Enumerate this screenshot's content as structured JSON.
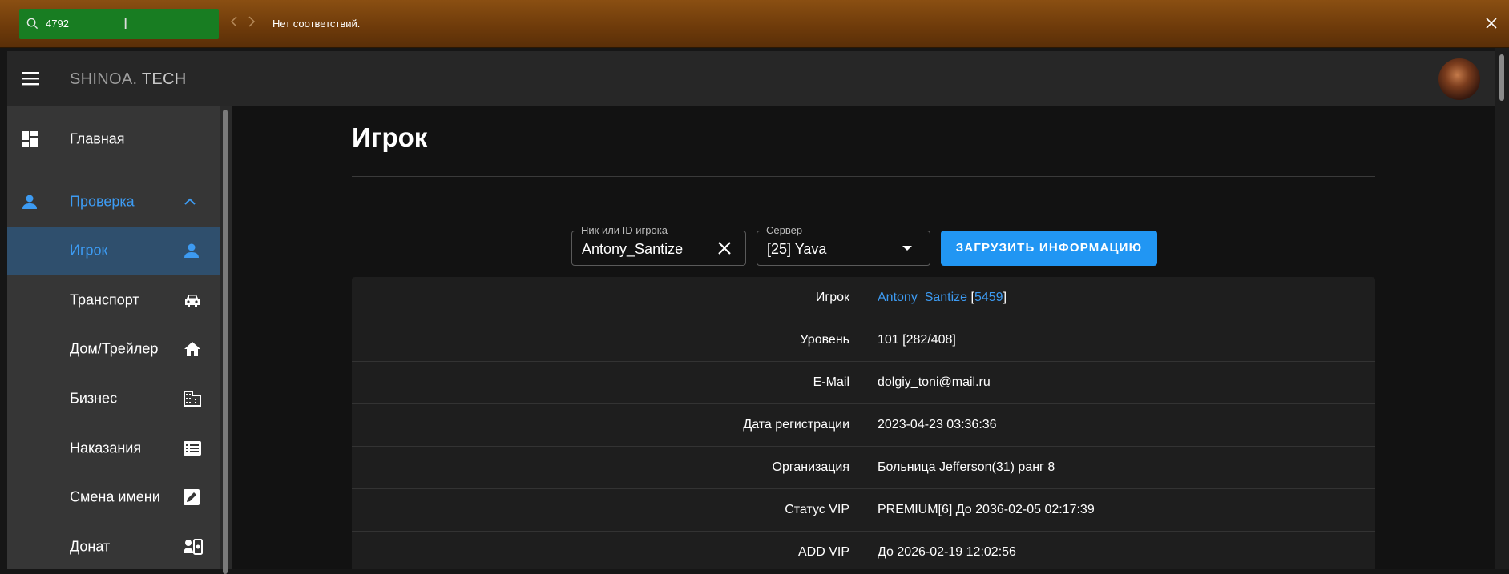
{
  "find_bar": {
    "query": "4792",
    "status": "Нет соответствий."
  },
  "app": {
    "brand_part1": "SHINOA.",
    "brand_part2": "TECH"
  },
  "sidebar": {
    "items": [
      {
        "label": "Главная",
        "icon": "dashboard-icon"
      },
      {
        "label": "Проверка",
        "icon": "person-icon",
        "expanded": true
      },
      {
        "label": "Игрок",
        "icon": "person-icon",
        "selected": true
      },
      {
        "label": "Транспорт",
        "icon": "car-icon"
      },
      {
        "label": "Дом/Трейлер",
        "icon": "home-icon"
      },
      {
        "label": "Бизнес",
        "icon": "business-icon"
      },
      {
        "label": "Наказания",
        "icon": "list-icon"
      },
      {
        "label": "Смена имени",
        "icon": "edit-icon"
      },
      {
        "label": "Донат",
        "icon": "donate-icon"
      }
    ]
  },
  "main": {
    "title": "Игрок",
    "search": {
      "nick_label": "Ник или ID игрока",
      "nick_value": "Antony_Santize",
      "server_label": "Сервер",
      "server_value": "[25] Yava",
      "load_button": "ЗАГРУЗИТЬ ИНФОРМАЦИЮ"
    },
    "info": {
      "player_key": "Игрок",
      "player_name": "Antony_Santize",
      "player_open": " [",
      "player_id": "5459",
      "player_close": "]",
      "rows": [
        {
          "key": "Уровень",
          "value": "101 [282/408]"
        },
        {
          "key": "E-Mail",
          "value": "dolgiy_toni@mail.ru"
        },
        {
          "key": "Дата регистрации",
          "value": "2023-04-23 03:36:36"
        },
        {
          "key": "Организация",
          "value": "Больница Jefferson(31) ранг 8"
        },
        {
          "key": "Статус VIP",
          "value": "PREMIUM[6] До 2036-02-05 02:17:39"
        },
        {
          "key": "ADD VIP",
          "value": "До 2026-02-19 12:02:56"
        }
      ]
    }
  },
  "colors": {
    "accent": "#2196f3",
    "link": "#3d9bf2",
    "selected_bg": "#2f4f6d",
    "find_bar": "#6d3a0a",
    "find_input": "#187d22"
  }
}
